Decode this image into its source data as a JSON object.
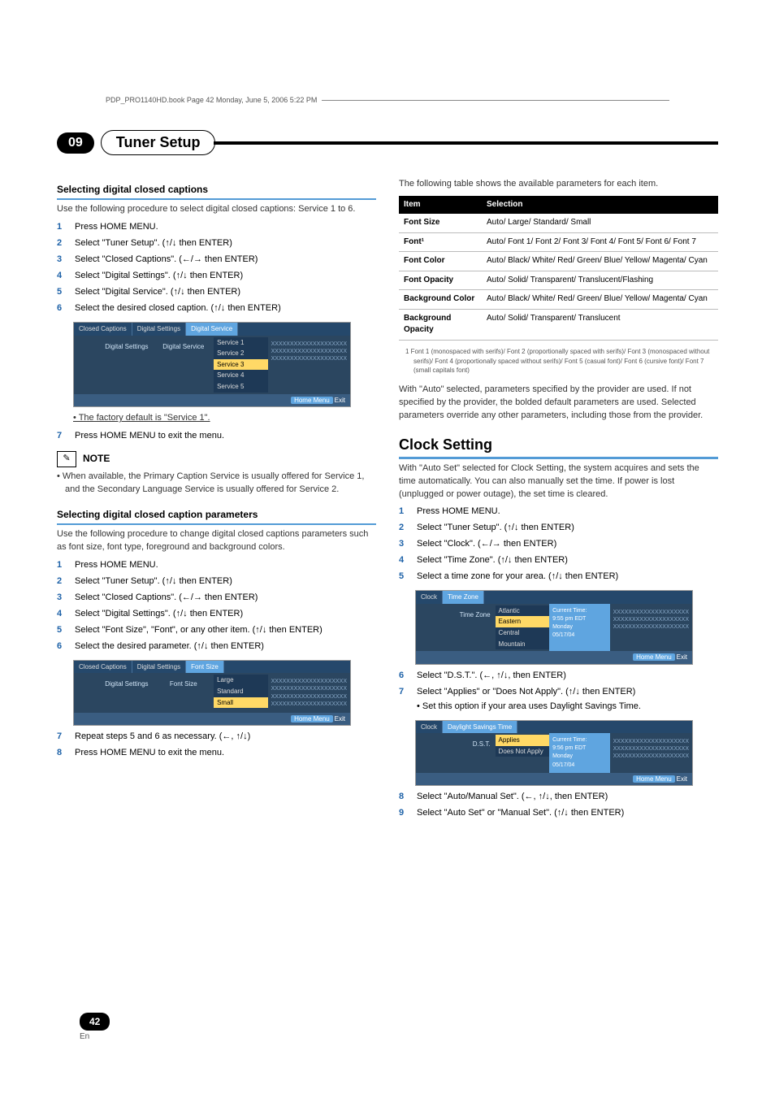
{
  "book_line": "PDP_PRO1140HD.book  Page 42  Monday, June 5, 2006  5:22 PM",
  "chapter_number": "09",
  "chapter_title": "Tuner Setup",
  "left": {
    "sec1_title": "Selecting digital closed captions",
    "sec1_intro": "Use the following procedure to select digital closed captions: Service 1 to 6.",
    "steps1": {
      "s1": "Press HOME MENU.",
      "s2": "Select \"Tuner Setup\". (↑/↓ then ENTER)",
      "s3": "Select \"Closed Captions\". (←/→ then ENTER)",
      "s4": "Select \"Digital Settings\". (↑/↓ then ENTER)",
      "s5": "Select \"Digital Service\". (↑/↓ then ENTER)",
      "s6": "Select the desired closed caption. (↑/↓ then ENTER)"
    },
    "menu1": {
      "crumb1": "Closed Captions",
      "crumb2": "Digital Settings",
      "crumb3": "Digital Service",
      "side_label": "Digital Settings",
      "mid_label": "Digital Service",
      "items": [
        "Service 1",
        "Service 2",
        "Service 3",
        "Service 4",
        "Service 5"
      ],
      "xs": "XXXXXXXXXXXXXXXXXXXX\nXXXXXXXXXXXXXXXXXXXX\nXXXXXXXXXXXXXXXXXXXX",
      "foot_btn": "Home Menu",
      "foot_txt": "Exit"
    },
    "factory_default": "• The factory default is \"Service 1\".",
    "step1_7": "Press HOME MENU to exit the menu.",
    "note_label": "NOTE",
    "note_text": "• When available, the Primary Caption Service is usually offered for Service 1, and the Secondary Language Service is usually offered for Service 2.",
    "sec2_title": "Selecting digital closed caption parameters",
    "sec2_intro": "Use the following procedure to change digital closed captions parameters such as font size, font type, foreground and background colors.",
    "steps2": {
      "s1": "Press HOME MENU.",
      "s2": "Select \"Tuner Setup\". (↑/↓ then ENTER)",
      "s3": "Select \"Closed Captions\". (←/→ then ENTER)",
      "s4": "Select \"Digital Settings\". (↑/↓ then ENTER)",
      "s5": "Select \"Font Size\", \"Font\", or any other item. (↑/↓ then ENTER)",
      "s6": "Select the desired parameter. (↑/↓ then ENTER)"
    },
    "menu2": {
      "crumb1": "Closed Captions",
      "crumb2": "Digital Settings",
      "crumb3": "Font Size",
      "side_label": "Digital Settings",
      "mid_label": "Font Size",
      "items": [
        "Large",
        "Standard",
        "Small"
      ],
      "xs": "XXXXXXXXXXXXXXXXXXXX\nXXXXXXXXXXXXXXXXXXXX\nXXXXXXXXXXXXXXXXXXXX\nXXXXXXXXXXXXXXXXXXXX",
      "foot_btn": "Home Menu",
      "foot_txt": "Exit"
    },
    "step2_7": "Repeat steps 5 and 6 as necessary. (←, ↑/↓)",
    "step2_8": "Press HOME MENU to exit the menu."
  },
  "right": {
    "table_intro": "The following table shows the available parameters for each item.",
    "table": {
      "h1": "Item",
      "h2": "Selection",
      "rows": [
        {
          "k": "Font Size",
          "v": "Auto/ Large/ Standard/ Small"
        },
        {
          "k": "Font¹",
          "v": "Auto/ Font 1/ Font 2/ Font 3/ Font 4/ Font 5/ Font 6/ Font 7"
        },
        {
          "k": "Font Color",
          "v": "Auto/ Black/ White/ Red/ Green/ Blue/ Yellow/ Magenta/ Cyan"
        },
        {
          "k": "Font Opacity",
          "v": "Auto/ Solid/ Transparent/ Translucent/Flashing"
        },
        {
          "k": "Background Color",
          "v": "Auto/ Black/ White/ Red/ Green/ Blue/ Yellow/ Magenta/ Cyan"
        },
        {
          "k": "Background Opacity",
          "v": "Auto/ Solid/ Transparent/ Translucent"
        }
      ]
    },
    "footnote": "1  Font 1 (monospaced with serifs)/ Font 2 (proportionally spaced with serifs)/ Font 3 (monospaced without serifs)/ Font 4 (proportionally spaced without serifs)/ Font 5 (casual font)/ Font 6 (cursive font)/ Font 7 (small capitals font)",
    "auto_note": "With \"Auto\" selected, parameters specified by the provider are used. If not specified by the provider, the bolded default parameters are used. Selected parameters override any other parameters, including those from the provider.",
    "clock_title": "Clock Setting",
    "clock_intro": "With \"Auto Set\" selected for Clock Setting, the system acquires and sets the time automatically. You can also manually set the time. If power is lost (unplugged or power outage), the set time is cleared.",
    "csteps": {
      "s1": "Press HOME MENU.",
      "s2": "Select \"Tuner Setup\". (↑/↓ then ENTER)",
      "s3": "Select \"Clock\". (←/→ then ENTER)",
      "s4": "Select \"Time Zone\". (↑/↓ then ENTER)",
      "s5": "Select a time zone for your area. (↑/↓ then ENTER)"
    },
    "menu3": {
      "crumb1": "Clock",
      "crumb2": "Time Zone",
      "side_label": "Time Zone",
      "items": [
        "Atlantic",
        "Eastern",
        "Central",
        "Mountain"
      ],
      "info_title": "Current Time:",
      "info_lines": [
        "9:55 pm EDT",
        "Monday",
        "05/17/04"
      ],
      "xs": "XXXXXXXXXXXXXXXXXXXX\nXXXXXXXXXXXXXXXXXXXX\nXXXXXXXXXXXXXXXXXXXX",
      "foot_btn": "Home Menu",
      "foot_txt": "Exit"
    },
    "cstep6": "Select \"D.S.T.\". (←, ↑/↓, then ENTER)",
    "cstep7": "Select \"Applies\" or \"Does Not Apply\". (↑/↓ then ENTER)",
    "cstep7_sub": "• Set this option if your area uses Daylight Savings Time.",
    "menu4": {
      "crumb1": "Clock",
      "crumb2": "Daylight Savings Time",
      "side_label": "D.S.T.",
      "items": [
        "Applies",
        "Does Not Apply"
      ],
      "info_title": "Current Time:",
      "info_lines": [
        "9:56 pm EDT",
        "Monday",
        "05/17/04"
      ],
      "xs": "XXXXXXXXXXXXXXXXXXXX\nXXXXXXXXXXXXXXXXXXXX\nXXXXXXXXXXXXXXXXXXXX",
      "foot_btn": "Home Menu",
      "foot_txt": "Exit"
    },
    "cstep8": "Select \"Auto/Manual Set\". (←, ↑/↓, then ENTER)",
    "cstep9": "Select \"Auto Set\" or \"Manual Set\". (↑/↓ then ENTER)"
  },
  "page_number": "42",
  "page_lang": "En"
}
